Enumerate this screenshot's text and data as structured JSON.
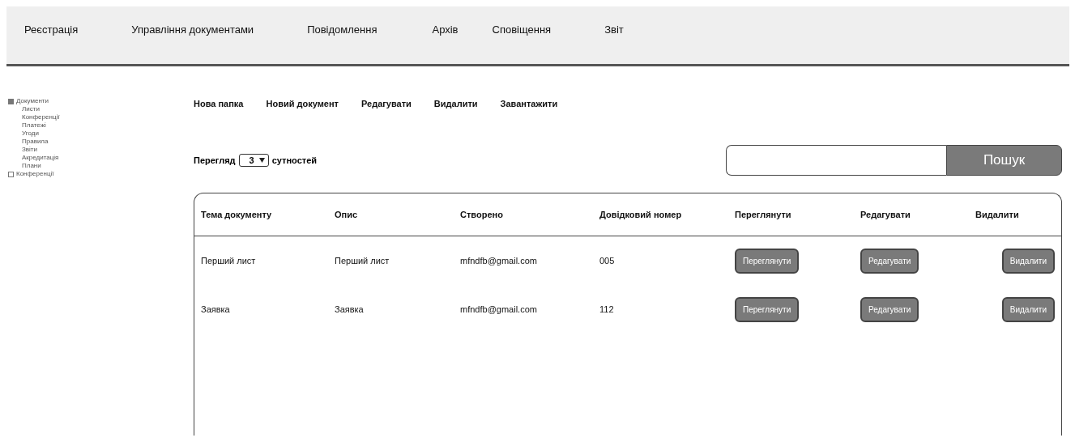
{
  "nav": [
    {
      "label": "Реєстрація"
    },
    {
      "label": "Управління документами"
    },
    {
      "label": "Повідомлення"
    },
    {
      "label": "Архів"
    },
    {
      "label": "Сповіщення"
    },
    {
      "label": "Звіт"
    }
  ],
  "sidebar": {
    "items": [
      {
        "label": "Документи",
        "expanded": true,
        "children": [
          {
            "label": "Листи"
          },
          {
            "label": "Конференції"
          },
          {
            "label": "Платежі"
          },
          {
            "label": "Угоди"
          },
          {
            "label": "Правила"
          },
          {
            "label": "Звіти"
          },
          {
            "label": "Акредитація"
          },
          {
            "label": "Плани"
          }
        ]
      },
      {
        "label": "Конференції",
        "expanded": false
      }
    ]
  },
  "toolbar": [
    "Нова папка",
    "Новий документ",
    "Редагувати",
    "Видалити",
    "Завантажити"
  ],
  "view": {
    "before": "Перегляд",
    "value": "3",
    "after": "сутностей"
  },
  "search": {
    "button": "Пошук"
  },
  "table": {
    "columns": [
      "Тема документу",
      "Опис",
      "Створено",
      "Довідковий номер",
      "Переглянути",
      "Редагувати",
      "Видалити"
    ],
    "rows": [
      {
        "cells": [
          "Перший лист",
          "Перший лист",
          "mfndfb@gmail.com",
          "005"
        ],
        "actions": [
          "Переглянути",
          "Редагувати",
          "Видалити"
        ]
      },
      {
        "cells": [
          "Заявка",
          "Заявка",
          "mfndfb@gmail.com",
          "112"
        ],
        "actions": [
          "Переглянути",
          "Редагувати",
          "Видалити"
        ]
      }
    ]
  }
}
